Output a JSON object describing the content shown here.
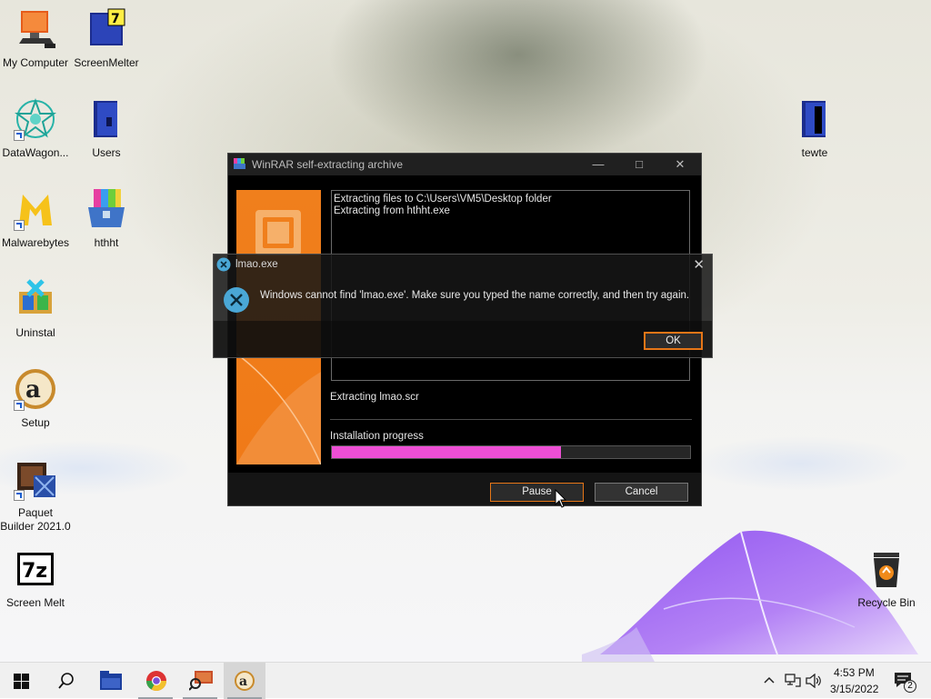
{
  "desktop": {
    "icons": [
      {
        "label": "My Computer"
      },
      {
        "label": "ScreenMelter"
      },
      {
        "label": "DataWagon..."
      },
      {
        "label": "Users"
      },
      {
        "label": "Malwarebytes"
      },
      {
        "label": "hthht"
      },
      {
        "label": "Uninstal"
      },
      {
        "label": "Setup"
      },
      {
        "label": "Paquet Builder 2021.0"
      },
      {
        "label": "Screen Melt"
      },
      {
        "label": "tewte"
      },
      {
        "label": "Recycle Bin"
      }
    ]
  },
  "winrar": {
    "title": "WinRAR self-extracting archive",
    "log_lines": [
      "Extracting files to C:\\Users\\VM5\\Desktop folder",
      "Extracting from hthht.exe"
    ],
    "current_file": "Extracting lmao.scr",
    "progress_label": "Installation progress",
    "progress": 0.64,
    "pause_label": "Pause",
    "cancel_label": "Cancel",
    "accent_color": "#f07f1c",
    "progress_color": "#ee4fd5"
  },
  "error_dialog": {
    "title": "lmao.exe",
    "message": "Windows cannot find 'lmao.exe'. Make sure you typed the name correctly, and then try again.",
    "ok_label": "OK"
  },
  "taskbar": {
    "items": [
      "start-icon",
      "search-icon",
      "file-explorer-icon",
      "chrome-icon",
      "app-icon",
      "setup-icon"
    ],
    "time": "4:53 PM",
    "date": "3/15/2022",
    "notification_count": "2"
  }
}
